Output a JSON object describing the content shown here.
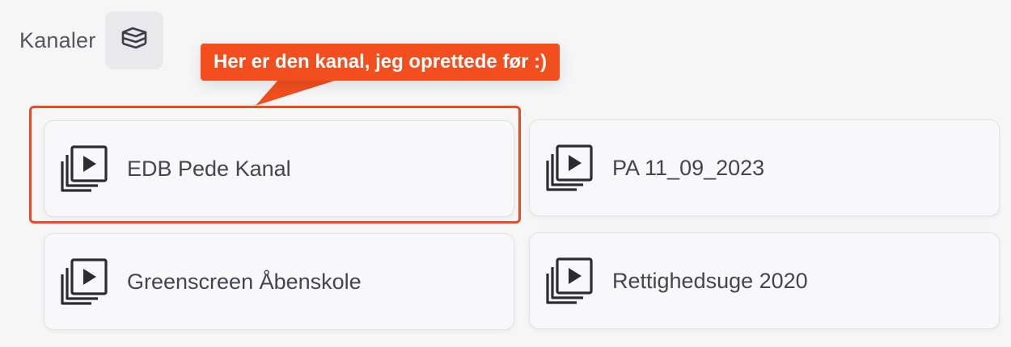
{
  "header": {
    "title": "Kanaler",
    "layers_icon": "stacked-layers-icon"
  },
  "annotation": {
    "text": "Her er den kanal, jeg oprettede før :)",
    "color": "#f24e1e"
  },
  "channels": [
    {
      "label": "EDB Pede Kanal",
      "icon": "video-playlist-icon",
      "highlighted": true
    },
    {
      "label": "PA 11_09_2023",
      "icon": "video-playlist-icon",
      "highlighted": false
    },
    {
      "label": "Greenscreen Åbenskole",
      "icon": "video-playlist-icon",
      "highlighted": false
    },
    {
      "label": "Rettighedsuge 2020",
      "icon": "video-playlist-icon",
      "highlighted": false
    }
  ]
}
